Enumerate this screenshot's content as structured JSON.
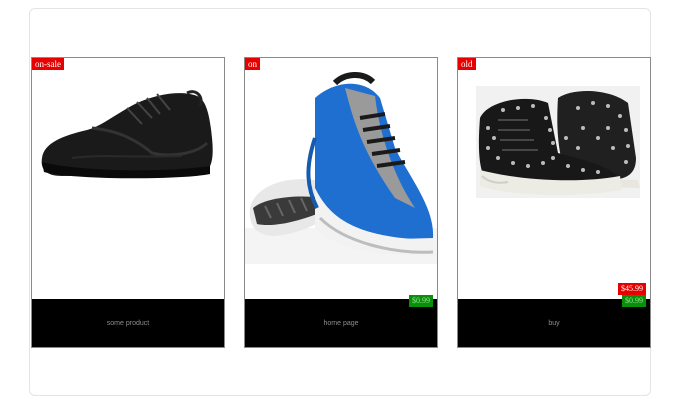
{
  "products": [
    {
      "tag": "on-sale",
      "label": "some product",
      "image": "black-sneaker"
    },
    {
      "tag": "on",
      "label": "home page",
      "price": "$0.99",
      "image": "blue-running-shoe"
    },
    {
      "tag": "old",
      "label": "buy",
      "price_old": "$45.99",
      "price": "$0.99",
      "image": "studded-high-top"
    }
  ],
  "colors": {
    "tag_bg": "#e60000",
    "price_bg": "#0a8f0a",
    "bar_bg": "#000000"
  }
}
